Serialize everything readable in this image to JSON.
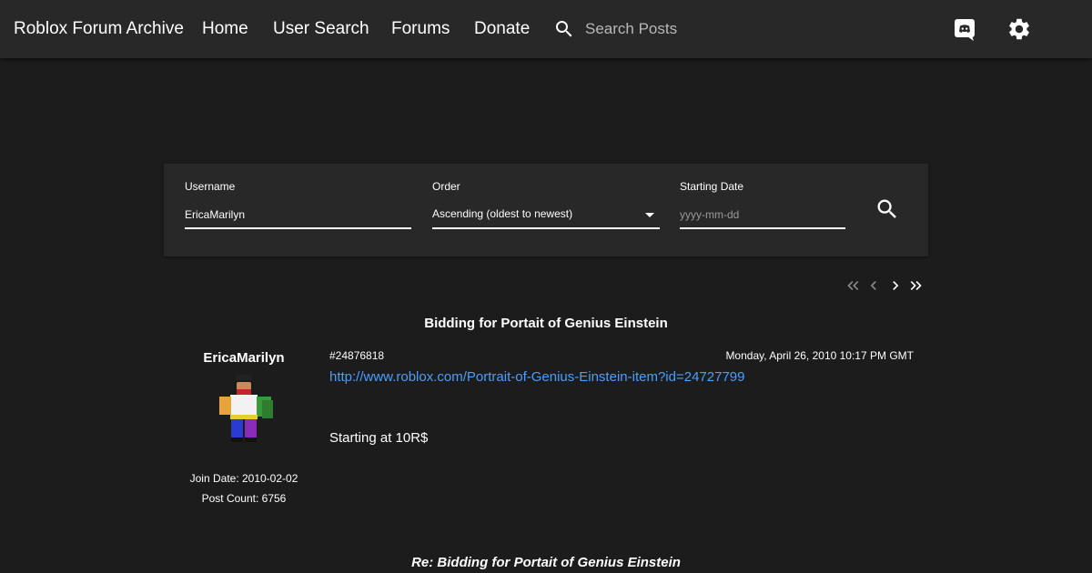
{
  "nav": {
    "brand": "Roblox Forum Archive",
    "links": [
      "Home",
      "User Search",
      "Forums",
      "Donate"
    ],
    "search_placeholder": "Search Posts",
    "icons": [
      "search-icon",
      "discord-icon",
      "settings-gear-icon"
    ]
  },
  "search_panel": {
    "username_label": "Username",
    "username_value": "EricaMarilyn",
    "order_label": "Order",
    "order_value": "Ascending (oldest to newest)",
    "date_label": "Starting Date",
    "date_placeholder": "yyyy-mm-dd"
  },
  "pagination": {
    "icons": [
      "first-page-icon",
      "previous-page-icon",
      "next-page-icon",
      "last-page-icon"
    ]
  },
  "thread": {
    "title": "Bidding for Portait of Genius Einstein",
    "post": {
      "author": "EricaMarilyn",
      "join_date": "Join Date: 2010-02-02",
      "post_count": "Post Count: 6756",
      "id": "#24876818",
      "date": "Monday, April 26, 2010 10:17 PM GMT",
      "link": "http://www.roblox.com/Portrait-of-Genius-Einstein-item?id=24727799",
      "body": "Starting at 10R$"
    },
    "next_post_title": "Re: Bidding for Portait of Genius Einstein"
  },
  "colors": {
    "background": "#1c1c1c",
    "bar": "#282828",
    "link": "#4a9eff"
  }
}
